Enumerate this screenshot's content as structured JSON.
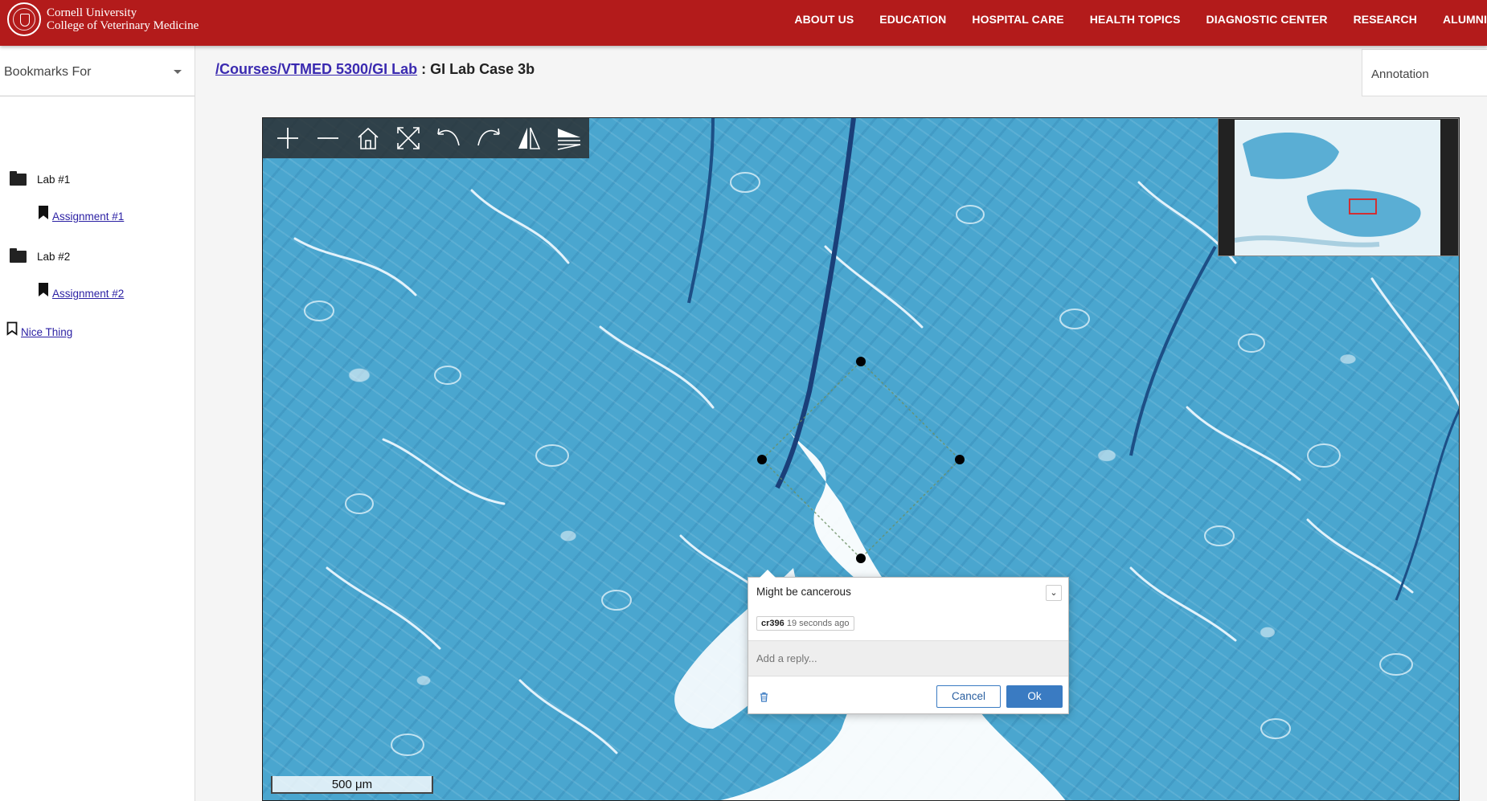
{
  "header": {
    "brand_line1": "Cornell University",
    "brand_line2": "College of Veterinary Medicine",
    "nav": [
      "ABOUT US",
      "EDUCATION",
      "HOSPITAL CARE",
      "HEALTH TOPICS",
      "DIAGNOSTIC CENTER",
      "RESEARCH",
      "ALUMNI"
    ]
  },
  "sidebar": {
    "select_label": "Bookmarks For",
    "folders": [
      {
        "label": "Lab #1",
        "bookmark": "Assignment #1"
      },
      {
        "label": "Lab #2",
        "bookmark": "Assignment #2"
      }
    ],
    "loose_bookmark": "Nice Thing"
  },
  "main": {
    "breadcrumb_link": "/Courses/VTMED 5300/GI Lab",
    "breadcrumb_sep": " : ",
    "breadcrumb_current": "GI Lab Case 3b",
    "annotation_label": "Annotation"
  },
  "viewer": {
    "scalebar": "500 μm",
    "toolbar_icons": [
      "zoom-in-icon",
      "zoom-out-icon",
      "home-icon",
      "fullscreen-icon",
      "rotate-left-icon",
      "rotate-right-icon",
      "flip-icon",
      "annotate-icon"
    ]
  },
  "comment": {
    "text": "Might be cancerous",
    "user": "cr396",
    "time": "19 seconds ago",
    "reply_placeholder": "Add a reply...",
    "cancel_label": "Cancel",
    "ok_label": "Ok"
  },
  "colors": {
    "header_red": "#b31b1b",
    "tissue_blue": "#4aa6cf",
    "link_purple": "#3a2ab0",
    "button_blue": "#3a7bc2"
  }
}
